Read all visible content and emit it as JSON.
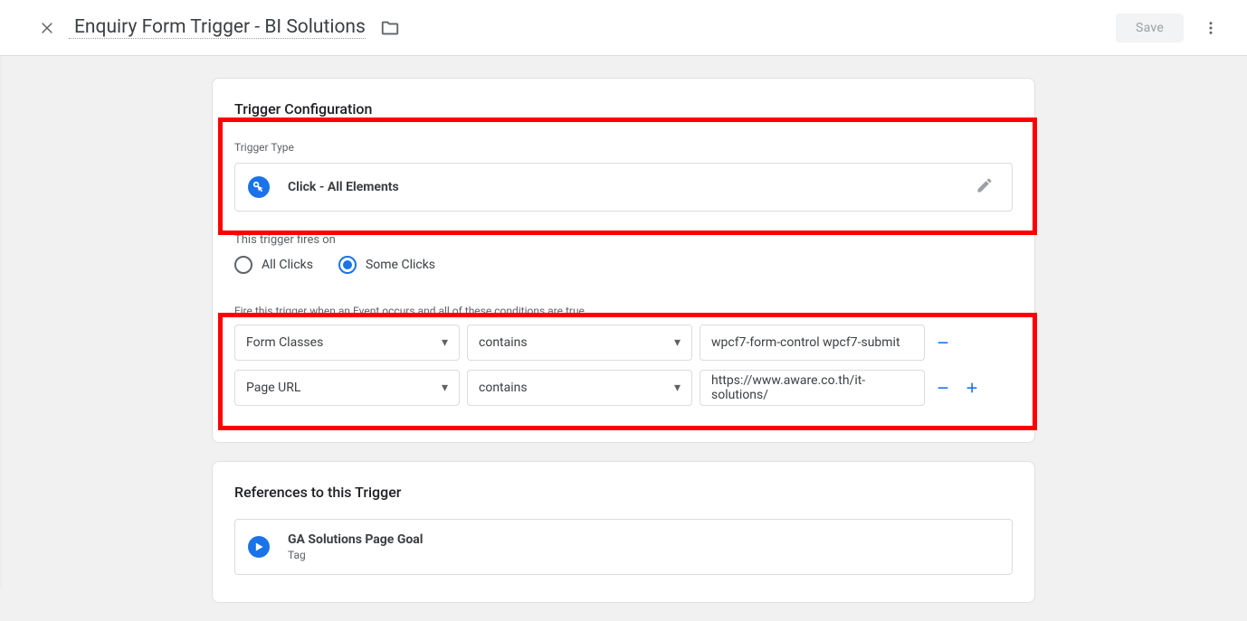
{
  "header": {
    "title": "Enquiry Form Trigger - BI Solutions",
    "save_label": "Save"
  },
  "trigger_config": {
    "heading": "Trigger Configuration",
    "type_label": "Trigger Type",
    "type_value": "Click - All Elements",
    "fires_on_label": "This trigger fires on",
    "radio_all": "All Clicks",
    "radio_some": "Some Clicks",
    "conditions_label": "Fire this trigger when an Event occurs and all of these conditions are true",
    "conditions": [
      {
        "variable": "Form Classes",
        "operator": "contains",
        "value": "wpcf7-form-control wpcf7-submit"
      },
      {
        "variable": "Page URL",
        "operator": "contains",
        "value": "https://www.aware.co.th/it-solutions/"
      }
    ]
  },
  "references": {
    "heading": "References to this Trigger",
    "items": [
      {
        "name": "GA Solutions Page Goal",
        "subtitle": "Tag"
      }
    ]
  }
}
